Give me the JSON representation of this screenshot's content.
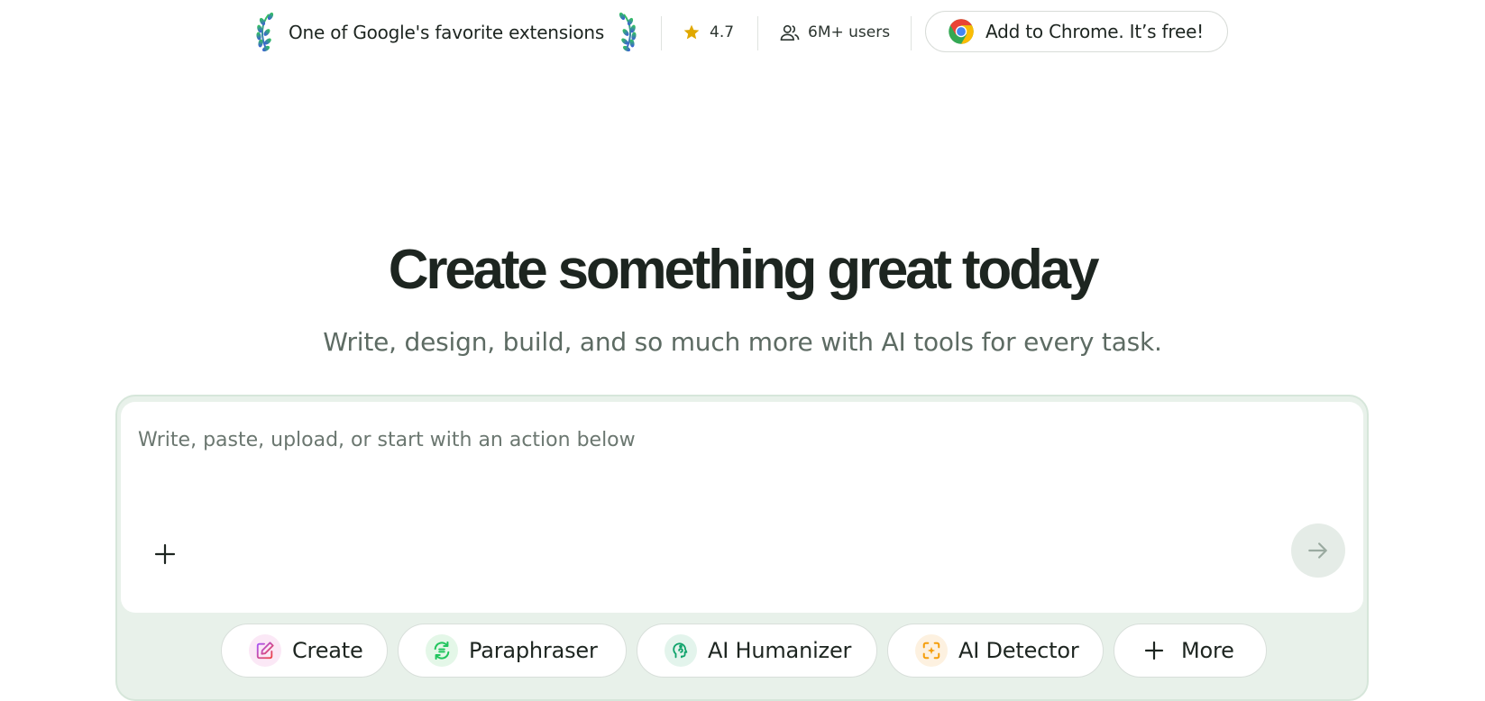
{
  "promo": {
    "award_text": "One of Google's favorite extensions",
    "rating": "4.7",
    "users": "6M+ users",
    "chrome_button_label": "Add to Chrome. It’s free!"
  },
  "hero": {
    "title": "Create something great today",
    "subtitle": "Write, design, build, and so much more with AI tools for every task."
  },
  "composer": {
    "placeholder": "Write, paste, upload, or start with an action below"
  },
  "actions": [
    {
      "label": "Create",
      "icon": "pencil-edit-icon",
      "color": "#d946ef"
    },
    {
      "label": "Paraphraser",
      "icon": "paraphrase-icon",
      "color": "#22c55e"
    },
    {
      "label": "AI Humanizer",
      "icon": "humanizer-head-icon",
      "color": "#10a36b"
    },
    {
      "label": "AI Detector",
      "icon": "detector-scan-icon",
      "color": "#f59e0b"
    },
    {
      "label": "More",
      "icon": "plus-icon",
      "color": "#1d2520"
    }
  ],
  "colors": {
    "text_dark": "#1d2520",
    "text_muted": "#5d6b63",
    "composer_bg": "#e8f1ea",
    "star": "#e0a800"
  }
}
